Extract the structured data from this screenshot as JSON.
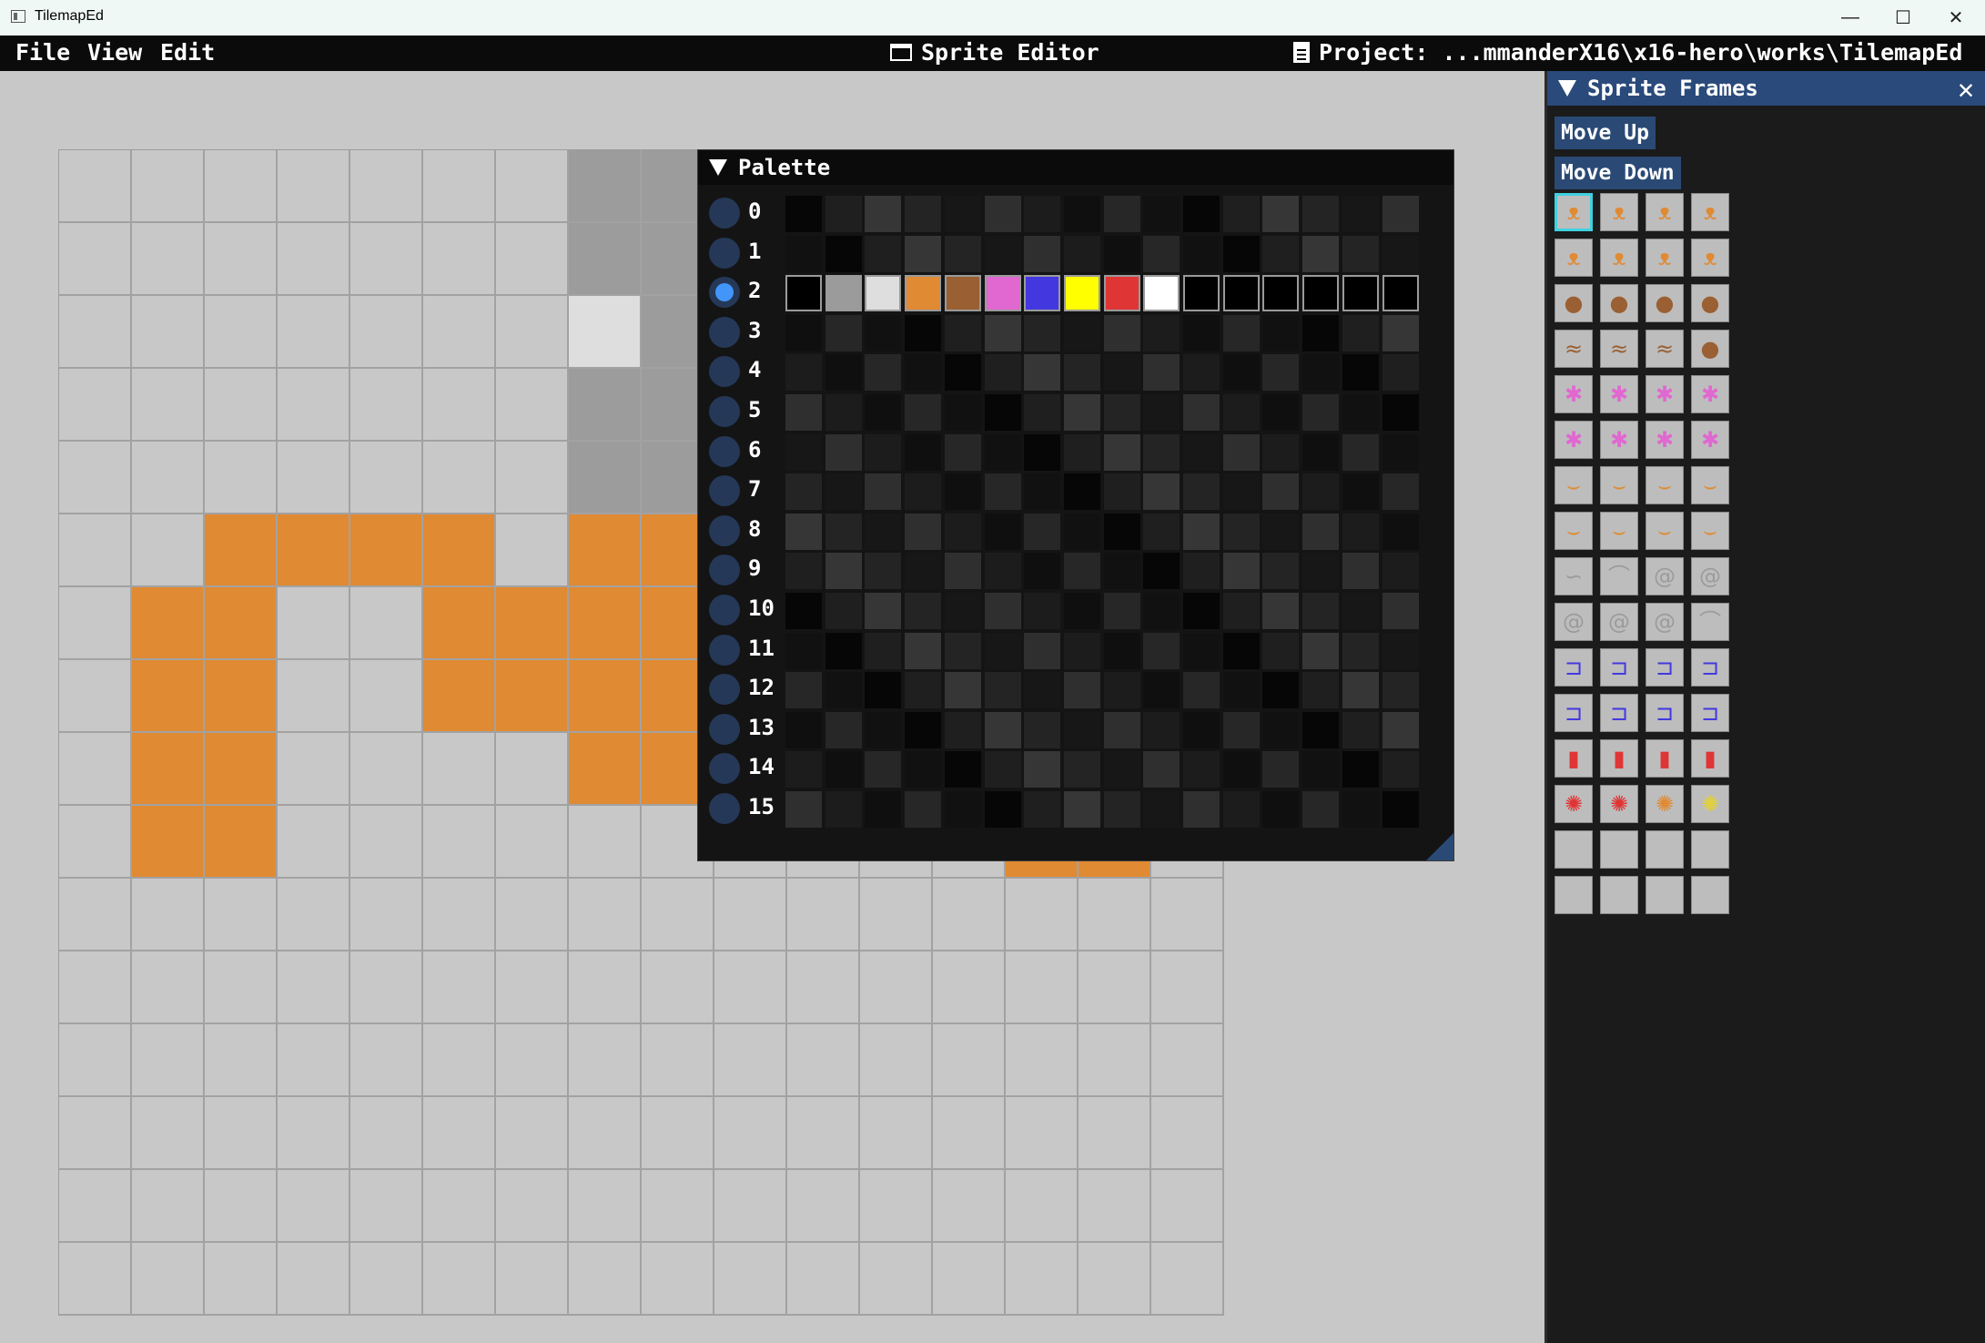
{
  "window": {
    "title": "TilemapEd",
    "minimize": "—",
    "maximize": "☐",
    "close": "✕"
  },
  "menubar": {
    "file": "File",
    "view": "View",
    "edit": "Edit",
    "center_title": "Sprite Editor",
    "project": "Project: ...mmanderX16\\x16-hero\\works\\TilemapEd"
  },
  "canvas": {
    "cols": 16,
    "rows": 16,
    "colors": {
      "lightgray": "#c8c8c8",
      "gray": "#9c9c9c",
      "white": "#dedede",
      "orange": "#e08a33"
    },
    "pixels": [
      "00000002222222222",
      "0000000222222222",
      "0000000322222222",
      "0000000222222222",
      "0000000222222222",
      "0011110111111111",
      "0110011111111110",
      "0110011111111100",
      "0110000111111100",
      "0110000000000110",
      "0000000000000000",
      "0000000000000000",
      "0000000000000000",
      "0000000000000000",
      "0000000000000000",
      "0000000000000000"
    ]
  },
  "palette": {
    "title": "Palette",
    "selected_row": 2,
    "rows": [
      "0",
      "1",
      "2",
      "3",
      "4",
      "5",
      "6",
      "7",
      "8",
      "9",
      "10",
      "11",
      "12",
      "13",
      "14",
      "15"
    ],
    "row2_colors": [
      "#000000",
      "#9b9b9b",
      "#dedede",
      "#e08a33",
      "#9a6033",
      "#e068d0",
      "#4338e0",
      "#ffff00",
      "#e03535",
      "#ffffff",
      "#000000",
      "#000000",
      "#000000",
      "#000000",
      "#000000",
      "#000000"
    ]
  },
  "frames": {
    "title": "Sprite Frames",
    "close": "✕",
    "move_up": "Move Up",
    "move_down": "Move Down",
    "thumbs": [
      {
        "icon": "hero-hanging",
        "glyph": "ᴥ",
        "color": "#e08a33"
      },
      {
        "icon": "hero-hanging",
        "glyph": "ᴥ",
        "color": "#e08a33"
      },
      {
        "icon": "hero-hanging",
        "glyph": "ᴥ",
        "color": "#e08a33"
      },
      {
        "icon": "hero-hanging",
        "glyph": "ᴥ",
        "color": "#e08a33"
      },
      {
        "icon": "hero-hanging",
        "glyph": "ᴥ",
        "color": "#e08a33"
      },
      {
        "icon": "hero-hanging",
        "glyph": "ᴥ",
        "color": "#e08a33"
      },
      {
        "icon": "hero-hanging",
        "glyph": "ᴥ",
        "color": "#e08a33"
      },
      {
        "icon": "hero-hanging",
        "glyph": "ᴥ",
        "color": "#e08a33"
      },
      {
        "icon": "brown-creature",
        "glyph": "●",
        "color": "#9a6033"
      },
      {
        "icon": "brown-creature",
        "glyph": "●",
        "color": "#9a6033"
      },
      {
        "icon": "brown-creature",
        "glyph": "●",
        "color": "#9a6033"
      },
      {
        "icon": "brown-creature",
        "glyph": "●",
        "color": "#9a6033"
      },
      {
        "icon": "brown-creature",
        "glyph": "≈",
        "color": "#9a6033"
      },
      {
        "icon": "brown-creature",
        "glyph": "≈",
        "color": "#9a6033"
      },
      {
        "icon": "brown-creature",
        "glyph": "≈",
        "color": "#9a6033"
      },
      {
        "icon": "brown-creature",
        "glyph": "●",
        "color": "#9a6033"
      },
      {
        "icon": "pink-spider",
        "glyph": "✱",
        "color": "#e068d0"
      },
      {
        "icon": "pink-spider",
        "glyph": "✱",
        "color": "#e068d0"
      },
      {
        "icon": "pink-spider",
        "glyph": "✱",
        "color": "#e068d0"
      },
      {
        "icon": "pink-spider",
        "glyph": "✱",
        "color": "#e068d0"
      },
      {
        "icon": "pink-spider",
        "glyph": "✱",
        "color": "#e068d0"
      },
      {
        "icon": "pink-spider",
        "glyph": "✱",
        "color": "#e068d0"
      },
      {
        "icon": "pink-spider",
        "glyph": "✱",
        "color": "#e068d0"
      },
      {
        "icon": "pink-spider",
        "glyph": "✱",
        "color": "#e068d0"
      },
      {
        "icon": "orange-bat",
        "glyph": "⌣",
        "color": "#e08a33"
      },
      {
        "icon": "orange-bat",
        "glyph": "⌣",
        "color": "#e08a33"
      },
      {
        "icon": "orange-bat",
        "glyph": "⌣",
        "color": "#e08a33"
      },
      {
        "icon": "orange-bat",
        "glyph": "⌣",
        "color": "#e08a33"
      },
      {
        "icon": "orange-bat",
        "glyph": "⌣",
        "color": "#e08a33"
      },
      {
        "icon": "orange-bat",
        "glyph": "⌣",
        "color": "#e08a33"
      },
      {
        "icon": "orange-bat",
        "glyph": "⌣",
        "color": "#e08a33"
      },
      {
        "icon": "orange-bat",
        "glyph": "⌣",
        "color": "#e08a33"
      },
      {
        "icon": "gray-snake",
        "glyph": "∽",
        "color": "#9b9b9b"
      },
      {
        "icon": "gray-snake",
        "glyph": "⌒",
        "color": "#9b9b9b"
      },
      {
        "icon": "gray-snake",
        "glyph": "@",
        "color": "#9b9b9b"
      },
      {
        "icon": "gray-snake",
        "glyph": "@",
        "color": "#9b9b9b"
      },
      {
        "icon": "gray-snake",
        "glyph": "@",
        "color": "#9b9b9b"
      },
      {
        "icon": "gray-snake",
        "glyph": "@",
        "color": "#9b9b9b"
      },
      {
        "icon": "gray-snake",
        "glyph": "@",
        "color": "#9b9b9b"
      },
      {
        "icon": "gray-snake",
        "glyph": "⌒",
        "color": "#9b9b9b"
      },
      {
        "icon": "blue-lamp",
        "glyph": "⊐",
        "color": "#4338e0"
      },
      {
        "icon": "blue-lamp",
        "glyph": "⊐",
        "color": "#4338e0"
      },
      {
        "icon": "blue-lamp",
        "glyph": "⊐",
        "color": "#4338e0"
      },
      {
        "icon": "blue-lamp",
        "glyph": "⊐",
        "color": "#4338e0"
      },
      {
        "icon": "blue-lamp",
        "glyph": "⊐",
        "color": "#4338e0"
      },
      {
        "icon": "blue-lamp",
        "glyph": "⊐",
        "color": "#4338e0"
      },
      {
        "icon": "blue-lamp",
        "glyph": "⊐",
        "color": "#4338e0"
      },
      {
        "icon": "blue-lamp",
        "glyph": "⊐",
        "color": "#4338e0"
      },
      {
        "icon": "dynamite",
        "glyph": "▮",
        "color": "#e03535"
      },
      {
        "icon": "dynamite",
        "glyph": "▮",
        "color": "#e03535"
      },
      {
        "icon": "dynamite",
        "glyph": "▮",
        "color": "#e03535"
      },
      {
        "icon": "dynamite",
        "glyph": "▮",
        "color": "#e03535"
      },
      {
        "icon": "explosion",
        "glyph": "✺",
        "color": "#e03535"
      },
      {
        "icon": "explosion",
        "glyph": "✺",
        "color": "#e03535"
      },
      {
        "icon": "explosion",
        "glyph": "✺",
        "color": "#e08a33"
      },
      {
        "icon": "explosion",
        "glyph": "✺",
        "color": "#e0d040"
      },
      {
        "icon": "empty-frame",
        "glyph": "",
        "color": "#9b9b9b"
      },
      {
        "icon": "empty-frame",
        "glyph": "",
        "color": "#9b9b9b"
      },
      {
        "icon": "empty-frame",
        "glyph": "",
        "color": "#9b9b9b"
      },
      {
        "icon": "empty-frame",
        "glyph": "",
        "color": "#9b9b9b"
      },
      {
        "icon": "empty-frame",
        "glyph": "",
        "color": "#9b9b9b"
      },
      {
        "icon": "empty-frame",
        "glyph": "",
        "color": "#9b9b9b"
      },
      {
        "icon": "empty-frame",
        "glyph": "",
        "color": "#9b9b9b"
      },
      {
        "icon": "empty-frame",
        "glyph": "",
        "color": "#9b9b9b"
      }
    ]
  }
}
